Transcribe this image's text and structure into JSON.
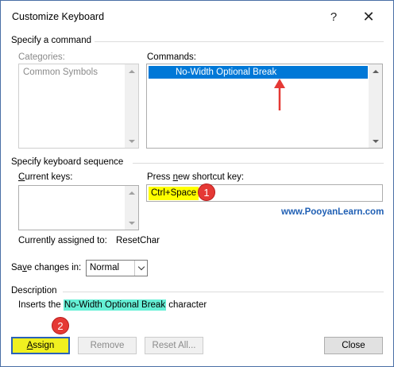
{
  "window": {
    "title": "Customize Keyboard",
    "help_glyph": "?",
    "close_glyph": "✕"
  },
  "command_group": {
    "label": "Specify a command",
    "categories": {
      "label": "Categories:",
      "items": [
        "Common Symbols"
      ]
    },
    "commands": {
      "label": "Commands:",
      "items": [
        "No-Width Optional Break"
      ]
    }
  },
  "keyboard_group": {
    "label": "Specify keyboard sequence",
    "current_keys": {
      "label_pre": "",
      "label_ul": "C",
      "label_post": "urrent keys:"
    },
    "new_shortcut": {
      "label_pre": "Press ",
      "label_ul": "n",
      "label_post": "ew shortcut key:",
      "value": "Ctrl+Space"
    },
    "assigned_label": "Currently assigned to:",
    "assigned_value": "ResetChar"
  },
  "save_changes": {
    "label_pre": "Sa",
    "label_ul": "v",
    "label_post": "e changes in:",
    "value": "Normal"
  },
  "description": {
    "label": "Description",
    "pre": "Inserts the ",
    "highlight": "No-Width Optional Break",
    "post": " character"
  },
  "buttons": {
    "assign_ul": "A",
    "assign_rest": "ssign",
    "remove": "Remove",
    "reset_all": "Reset All...",
    "close": "Close"
  },
  "annotations": {
    "badge_1": "1",
    "badge_2": "2",
    "watermark": "www.PooyanLearn.com"
  },
  "colors": {
    "selection": "#0078d7",
    "shortcut_highlight": "#ffff00",
    "description_highlight": "#66f0d6",
    "badge": "#e53935",
    "assign_button": "#f0f020",
    "watermark": "#1f5fb4"
  }
}
